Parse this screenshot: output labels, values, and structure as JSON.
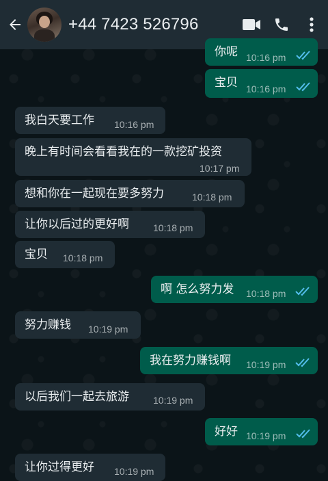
{
  "header": {
    "back_icon": "arrow-left-icon",
    "contact_name": "+44 7423 526796",
    "video_icon": "video-camera-icon",
    "call_icon": "phone-icon",
    "menu_icon": "more-vertical-icon"
  },
  "colors": {
    "header_bg": "#1f2c34",
    "incoming_bg": "#1f2c34",
    "outgoing_bg": "#005c4b",
    "read_ticks": "#53bdeb"
  },
  "messages": [
    {
      "direction": "out",
      "text": "你呢",
      "time": "10:16 pm",
      "status": "read"
    },
    {
      "direction": "out",
      "text": "宝贝",
      "time": "10:16 pm",
      "status": "read"
    },
    {
      "direction": "in",
      "text": "我白天要工作",
      "time": "10:16 pm"
    },
    {
      "direction": "in",
      "text": "晚上有时间会看看我在的一款挖矿投资",
      "time": "10:17 pm"
    },
    {
      "direction": "in",
      "text": "想和你在一起现在要多努力",
      "time": "10:18 pm"
    },
    {
      "direction": "in",
      "text": "让你以后过的更好啊",
      "time": "10:18 pm"
    },
    {
      "direction": "in",
      "text": "宝贝",
      "time": "10:18 pm"
    },
    {
      "direction": "out",
      "text": "啊 怎么努力发",
      "time": "10:18 pm",
      "status": "read"
    },
    {
      "direction": "in",
      "text": "努力赚钱",
      "time": "10:19 pm"
    },
    {
      "direction": "out",
      "text": "我在努力赚钱啊",
      "time": "10:19 pm",
      "status": "read"
    },
    {
      "direction": "in",
      "text": "以后我们一起去旅游",
      "time": "10:19 pm"
    },
    {
      "direction": "out",
      "text": "好好",
      "time": "10:19 pm",
      "status": "read"
    },
    {
      "direction": "in",
      "text": "让你过得更好",
      "time": "10:19 pm"
    }
  ]
}
